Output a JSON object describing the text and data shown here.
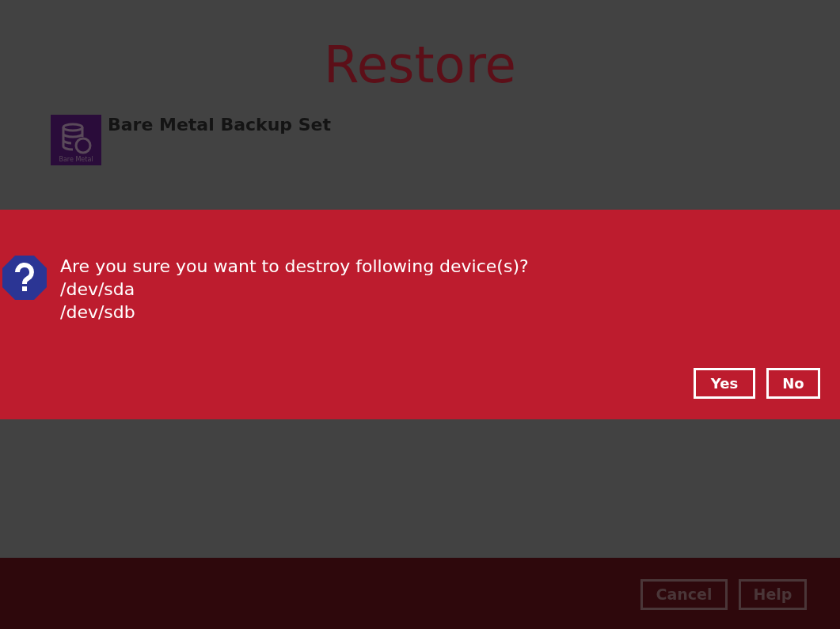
{
  "window": {
    "title": "Restore"
  },
  "backup_set": {
    "icon_label": "Bare Metal",
    "name": "Bare Metal Backup Set"
  },
  "dialog": {
    "lines": [
      "Are you sure you want to destroy following device(s)?",
      "/dev/sda",
      "/dev/sdb"
    ],
    "buttons": [
      "Yes",
      "No"
    ]
  },
  "footer": {
    "buttons": [
      {
        "label": "Cancel",
        "disabled": true
      },
      {
        "label": "Help",
        "disabled": true
      }
    ]
  }
}
